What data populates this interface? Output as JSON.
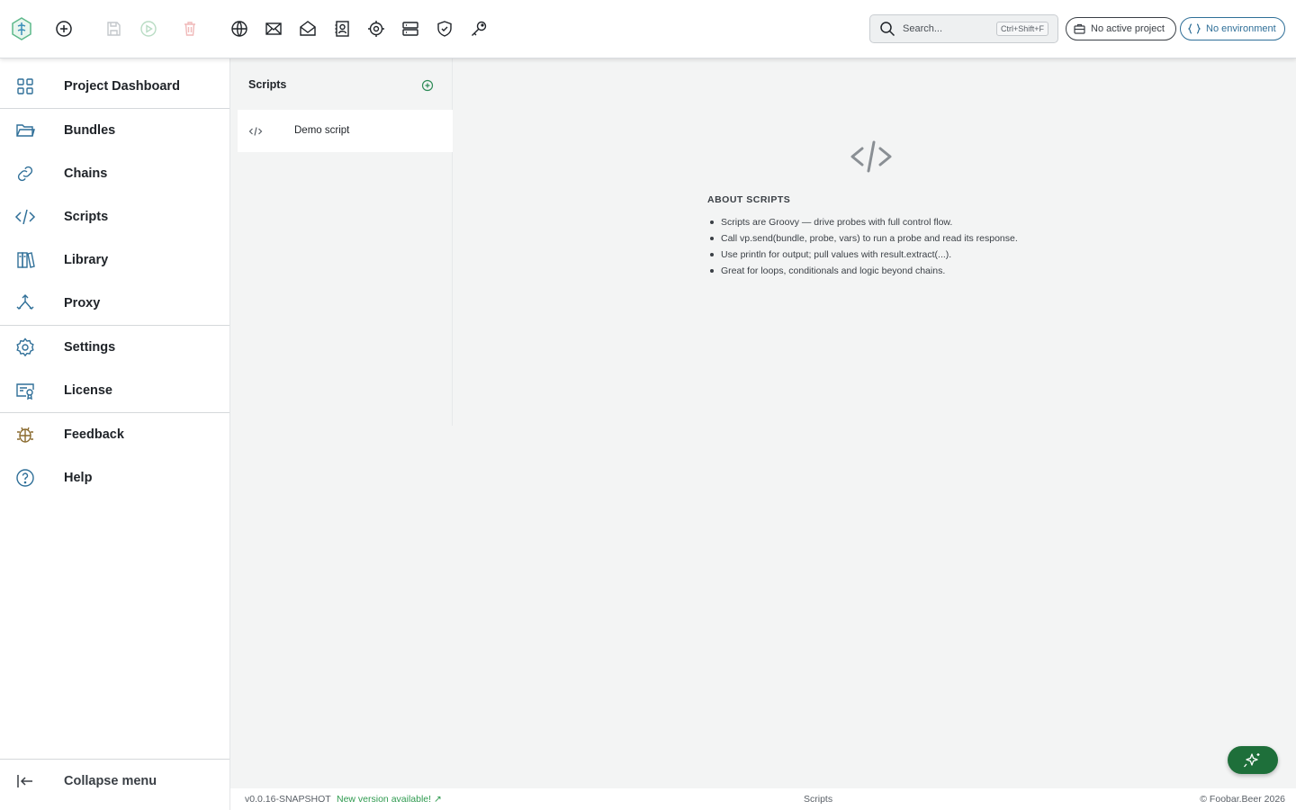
{
  "toolbar": {
    "search_placeholder": "Search...",
    "search_shortcut": "Ctrl+Shift+F",
    "project_pill": "No active project",
    "environment_pill": "No environment"
  },
  "sidebar": {
    "items": [
      {
        "label": "Project Dashboard",
        "icon": "grid-icon"
      },
      {
        "label": "Bundles",
        "icon": "folder-icon"
      },
      {
        "label": "Chains",
        "icon": "link-icon"
      },
      {
        "label": "Scripts",
        "icon": "code-icon"
      },
      {
        "label": "Library",
        "icon": "books-icon"
      },
      {
        "label": "Proxy",
        "icon": "split-arrows-icon"
      },
      {
        "label": "Settings",
        "icon": "gear-icon"
      },
      {
        "label": "License",
        "icon": "certificate-icon"
      },
      {
        "label": "Feedback",
        "icon": "bug-icon"
      },
      {
        "label": "Help",
        "icon": "help-icon"
      }
    ],
    "collapse_label": "Collapse menu"
  },
  "scripts_panel": {
    "title": "Scripts",
    "items": [
      {
        "label": "Demo script"
      }
    ]
  },
  "about": {
    "heading": "ABOUT SCRIPTS",
    "points": [
      "Scripts are Groovy — drive probes with full control flow.",
      "Call vp.send(bundle, probe, vars) to run a probe and read its response.",
      "Use println for output; pull values with result.extract(...).",
      "Great for loops, conditionals and logic beyond chains."
    ]
  },
  "footer": {
    "version": "v0.0.16-SNAPSHOT",
    "update": "New version available! ↗",
    "current_view": "Scripts",
    "copyright": "© Foobar.Beer 2026"
  },
  "colors": {
    "accent_blue": "#2f6f98",
    "accent_green": "#1e6f3a",
    "update_green": "#2e9a4f",
    "feedback_brown": "#8a6a2e"
  }
}
